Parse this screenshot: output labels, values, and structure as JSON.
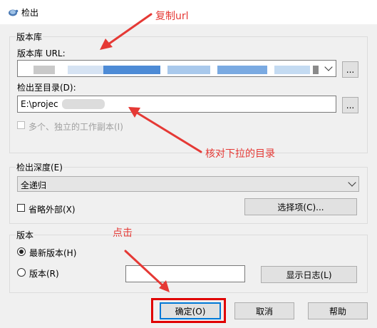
{
  "window": {
    "title": "检出"
  },
  "repository": {
    "group_label": "版本库",
    "url_label": "版本库 URL:",
    "url_value": "",
    "browse_label": "...",
    "checkout_dir_label": "检出至目录(D):",
    "checkout_dir_value": "E:\\projec",
    "browse_dir_label": "...",
    "multi_copy_label": "多个、独立的工作副本(I)",
    "multi_copy_checked": false
  },
  "depth": {
    "group_label": "检出深度(E)",
    "selected": "全递归",
    "omit_externals_label": "省略外部(X)",
    "omit_externals_checked": false,
    "choose_items_label": "选择项(C)..."
  },
  "revision": {
    "group_label": "版本",
    "head_label": "最新版本(H)",
    "head_selected": true,
    "revision_label": "版本(R)",
    "revision_value": "",
    "show_log_label": "显示日志(L)"
  },
  "buttons": {
    "ok": "确定(O)",
    "cancel": "取消",
    "help": "帮助"
  },
  "annotations": {
    "copy_url": "复制url",
    "check_dir": "核对下拉的目录",
    "click": "点击"
  },
  "colors": {
    "annotation": "#e53935",
    "focus_button_border": "#0078d7",
    "highlight_box": "#e00000"
  }
}
